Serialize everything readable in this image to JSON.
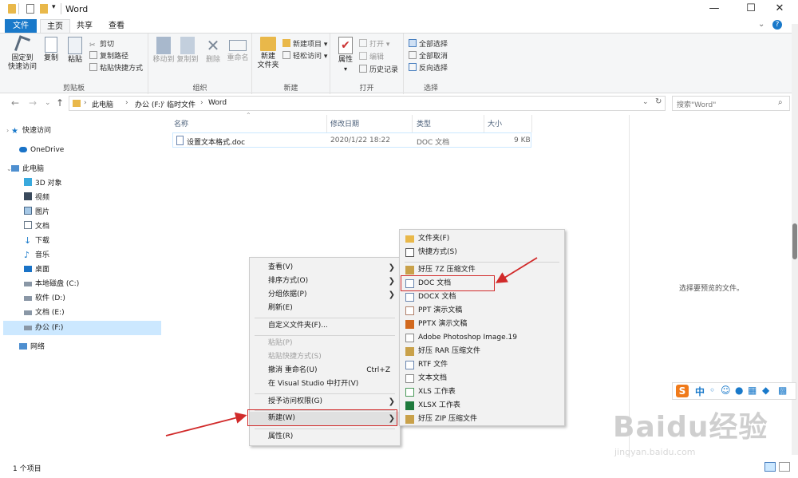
{
  "window": {
    "title": "Word",
    "controls": {
      "minimize": "—",
      "maximize": "☐",
      "close": "✕"
    }
  },
  "ribbon_tabs": [
    "文件",
    "主页",
    "共享",
    "查看"
  ],
  "ribbon": {
    "clipboard": {
      "label": "剪贴板",
      "pin": "固定到\n快速访问",
      "copy": "复制",
      "paste": "粘贴",
      "cut": "剪切",
      "copy_path": "复制路径",
      "paste_shortcut": "粘贴快捷方式"
    },
    "organize": {
      "label": "组织",
      "move_to": "移动到",
      "copy_to": "复制到",
      "delete": "删除",
      "rename": "重命名"
    },
    "new": {
      "label": "新建",
      "new_folder": "新建\n文件夹",
      "new_item": "新建项目",
      "easy_access": "轻松访问"
    },
    "open": {
      "label": "打开",
      "properties": "属性",
      "open": "打开",
      "edit": "编辑",
      "history": "历史记录"
    },
    "select": {
      "label": "选择",
      "select_all": "全部选择",
      "select_none": "全部取消",
      "invert": "反向选择"
    }
  },
  "address": {
    "breadcrumb": [
      "此电脑",
      "办公 (F:)",
      "临时文件",
      "Word"
    ],
    "search_placeholder": "搜索\"Word\""
  },
  "nav": [
    {
      "label": "快速访问",
      "icon": "star-icon"
    },
    {
      "label": "OneDrive",
      "icon": "cloud-icon"
    },
    {
      "label": "此电脑",
      "icon": "pc-icon"
    },
    {
      "label": "3D 对象",
      "icon": "cube-icon"
    },
    {
      "label": "视频",
      "icon": "video-icon"
    },
    {
      "label": "图片",
      "icon": "picture-icon"
    },
    {
      "label": "文档",
      "icon": "document-icon"
    },
    {
      "label": "下载",
      "icon": "download-icon"
    },
    {
      "label": "音乐",
      "icon": "music-icon"
    },
    {
      "label": "桌面",
      "icon": "desktop-icon"
    },
    {
      "label": "本地磁盘 (C:)",
      "icon": "drive-icon"
    },
    {
      "label": "软件 (D:)",
      "icon": "drive-icon"
    },
    {
      "label": "文档 (E:)",
      "icon": "drive-icon"
    },
    {
      "label": "办公 (F:)",
      "icon": "drive-icon"
    },
    {
      "label": "网络",
      "icon": "network-icon"
    }
  ],
  "columns": [
    "名称",
    "修改日期",
    "类型",
    "大小"
  ],
  "files": [
    {
      "name": "设置文本格式.doc",
      "modified": "2020/1/22 18:22",
      "type": "DOC 文档",
      "size": "9 KB"
    }
  ],
  "preview_text": "选择要预览的文件。",
  "status": {
    "count": "1 个项目"
  },
  "context_menu": [
    {
      "label": "查看(V)",
      "arrow": "❯"
    },
    {
      "label": "排序方式(O)",
      "arrow": "❯"
    },
    {
      "label": "分组依据(P)",
      "arrow": "❯"
    },
    {
      "label": "刷新(E)"
    },
    {
      "label": "自定义文件夹(F)..."
    },
    {
      "label": "粘贴(P)",
      "disabled": true
    },
    {
      "label": "粘贴快捷方式(S)",
      "disabled": true
    },
    {
      "label": "撤消 重命名(U)",
      "shortcut": "Ctrl+Z"
    },
    {
      "label": "在 Visual Studio 中打开(V)"
    },
    {
      "label": "授予访问权限(G)",
      "arrow": "❯"
    },
    {
      "label": "新建(W)",
      "arrow": "❯"
    },
    {
      "label": "属性(R)"
    }
  ],
  "new_submenu": [
    {
      "label": "文件夹(F)",
      "icon": "folder-icon"
    },
    {
      "label": "快捷方式(S)",
      "icon": "shortcut-icon"
    },
    {
      "label": "好压 7Z 压缩文件",
      "icon": "archive-icon"
    },
    {
      "label": "DOC 文档",
      "icon": "doc-icon"
    },
    {
      "label": "DOCX 文档",
      "icon": "docx-icon"
    },
    {
      "label": "PPT 演示文稿",
      "icon": "ppt-icon"
    },
    {
      "label": "PPTX 演示文稿",
      "icon": "pptx-icon"
    },
    {
      "label": "Adobe Photoshop Image.19",
      "icon": "psd-icon"
    },
    {
      "label": "好压 RAR 压缩文件",
      "icon": "archive-icon"
    },
    {
      "label": "RTF 文件",
      "icon": "rtf-icon"
    },
    {
      "label": "文本文档",
      "icon": "text-icon"
    },
    {
      "label": "XLS 工作表",
      "icon": "xls-icon"
    },
    {
      "label": "XLSX 工作表",
      "icon": "xlsx-icon"
    },
    {
      "label": "好压 ZIP 压缩文件",
      "icon": "archive-icon"
    }
  ],
  "ime_bar": {
    "logo": "S",
    "lang": "中"
  },
  "watermark": {
    "text": "Baidu经验",
    "url": "jingyan.baidu.com"
  }
}
